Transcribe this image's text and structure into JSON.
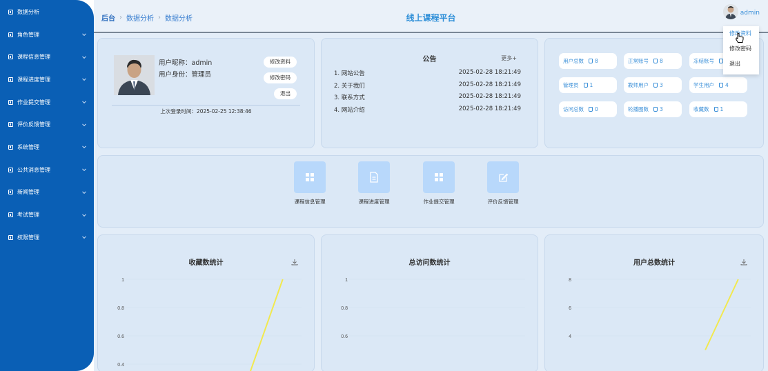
{
  "sidebar": {
    "items": [
      {
        "label": "数据分析",
        "expandable": false
      },
      {
        "label": "角色管理",
        "expandable": true
      },
      {
        "label": "课程信息管理",
        "expandable": true
      },
      {
        "label": "课程进度管理",
        "expandable": true
      },
      {
        "label": "作业提交管理",
        "expandable": true
      },
      {
        "label": "评价反馈管理",
        "expandable": true
      },
      {
        "label": "系统管理",
        "expandable": true
      },
      {
        "label": "公共消息管理",
        "expandable": true
      },
      {
        "label": "新闻管理",
        "expandable": true
      },
      {
        "label": "考试管理",
        "expandable": true
      },
      {
        "label": "权限管理",
        "expandable": true
      }
    ]
  },
  "header": {
    "breadcrumb": [
      "后台",
      "数据分析",
      "数据分析"
    ],
    "title": "线上课程平台",
    "username": "admin",
    "dropdown": [
      "修改资料",
      "修改密码",
      "退出"
    ]
  },
  "profile": {
    "nickname": "用户昵称：admin",
    "role": "用户身份：管理员",
    "buttons": [
      "修改资料",
      "修改密码",
      "退出"
    ],
    "last_login": "上次登录时间：2025-02-25 12:38:46"
  },
  "notice": {
    "title": "公告",
    "more": "更多+",
    "items": [
      {
        "title": "1. 网站公告",
        "time": "2025-02-28 18:21:49"
      },
      {
        "title": "2. 关于我们",
        "time": "2025-02-28 18:21:49"
      },
      {
        "title": "3. 联系方式",
        "time": "2025-02-28 18:21:49"
      },
      {
        "title": "4. 网站介绍",
        "time": "2025-02-28 18:21:49"
      }
    ]
  },
  "stats": [
    {
      "label": "用户总数",
      "value": "8"
    },
    {
      "label": "正常账号",
      "value": "8"
    },
    {
      "label": "冻结账号",
      "value": ""
    },
    {
      "label": "管理员",
      "value": "1"
    },
    {
      "label": "教师用户",
      "value": "3"
    },
    {
      "label": "学生用户",
      "value": "4"
    },
    {
      "label": "访问总数",
      "value": "0"
    },
    {
      "label": "轮播图数",
      "value": "3"
    },
    {
      "label": "收藏数",
      "value": "1"
    }
  ],
  "quick_nav": [
    {
      "label": "课程信息管理",
      "icon": "grid-icon"
    },
    {
      "label": "课程进度管理",
      "icon": "document-icon"
    },
    {
      "label": "作业提交管理",
      "icon": "grid-icon"
    },
    {
      "label": "评价反馈管理",
      "icon": "edit-icon"
    }
  ],
  "colors": {
    "sidebar": "#0a5fb5",
    "accent": "#3a8fd8",
    "line": "#f2e94e"
  },
  "chart_data": [
    {
      "type": "line",
      "title": "收藏数统计",
      "yticks": [
        "1",
        "0.8",
        "0.6",
        "0.4"
      ],
      "ylim": [
        0.4,
        1
      ],
      "points_visible": [
        [
          0.69,
          0.3
        ],
        [
          0.85,
          1
        ]
      ]
    },
    {
      "type": "line",
      "title": "总访问数统计",
      "yticks": [
        "1",
        "0.8",
        "0.6"
      ],
      "ylim": [
        0.6,
        1
      ],
      "points_visible": []
    },
    {
      "type": "line",
      "title": "用户总数统计",
      "yticks": [
        "8",
        "6",
        "4"
      ],
      "ylim": [
        4,
        8
      ],
      "points_visible": [
        [
          0.73,
          3
        ],
        [
          0.88,
          8
        ]
      ]
    }
  ]
}
